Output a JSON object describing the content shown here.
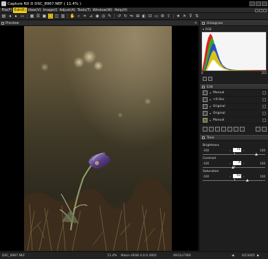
{
  "window": {
    "title": "Capture NX D    DSC_8967.NEF ( 11.4% )"
  },
  "menu": [
    {
      "label": "File(F)",
      "active": false
    },
    {
      "label": "Edit(E)",
      "active": true
    },
    {
      "label": "View(V)",
      "active": false
    },
    {
      "label": "Image(I)",
      "active": false
    },
    {
      "label": "Adjust(A)",
      "active": false
    },
    {
      "label": "Tools(T)",
      "active": false
    },
    {
      "label": "Window(W)",
      "active": false
    },
    {
      "label": "Help(H)",
      "active": false
    }
  ],
  "preview": {
    "title": "Preview",
    "close": "✕"
  },
  "histogram": {
    "title": "Histogram",
    "channel": "RGB",
    "scale_min": "0",
    "scale_max": "255"
  },
  "edit": {
    "title": "Edit",
    "rows": [
      {
        "icon": "white-balance-icon",
        "label": "Manual"
      },
      {
        "icon": "exposure-icon",
        "label": "+0.0ev"
      },
      {
        "icon": "picture-control-icon",
        "label": "Original"
      },
      {
        "icon": "noise-reduction-icon",
        "label": "Original"
      },
      {
        "icon": "lens-correction-icon",
        "label": "Manual"
      }
    ]
  },
  "tone": {
    "title": "Tone",
    "sliders": [
      {
        "label": "Brightness",
        "min": "-100",
        "max": "100",
        "value": "71",
        "level": 71
      },
      {
        "label": "Contrast",
        "min": "-100",
        "max": "100",
        "value": "-4",
        "level": -4
      },
      {
        "label": "Saturation",
        "min": "-100",
        "max": "100",
        "value": "43",
        "level": 43
      }
    ]
  },
  "status": {
    "filename": "DSC_8967.NEF",
    "zoom": "11.4%",
    "profile": "Nikon sRGB 4.0.0.3002",
    "dimensions": "4912x7360",
    "position": "4/13445"
  }
}
